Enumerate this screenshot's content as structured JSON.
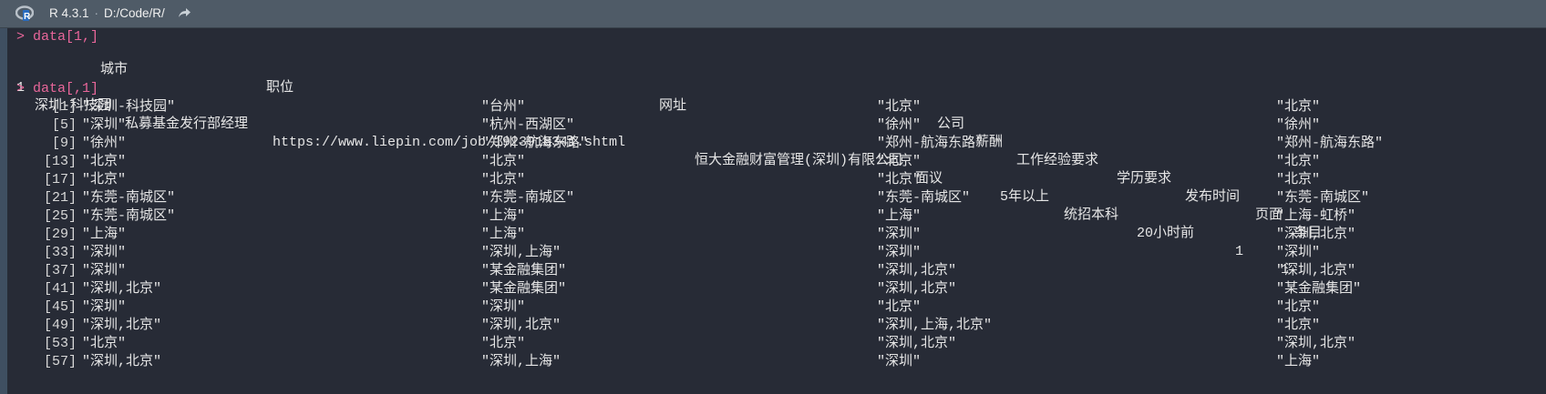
{
  "titlebar": {
    "r_version": "R 4.3.1",
    "path": "D:/Code/R/",
    "logo_icon": "r-logo-icon",
    "share_icon": "share-arrow-icon"
  },
  "console": {
    "cmd1": "> data[1,]",
    "header": [
      "城市",
      "职位",
      "网址",
      "公司",
      "薪酬",
      "工作经验要求",
      "学历要求",
      "发布时间",
      "页面",
      "条目"
    ],
    "row1": [
      "1",
      "深圳-科技园",
      "私募基金发行部经理",
      "https://www.liepin.com/job/1923918341.shtml",
      "恒大金融财富管理(深圳)有限公司",
      "面议",
      "5年以上",
      "统招本科",
      "20小时前",
      "1",
      "1"
    ],
    "cmd2": "> data[,1]",
    "vector_rows": [
      {
        "index": "[1]",
        "values": [
          "\"深圳-科技园\"",
          "\"台州\"",
          "\"北京\"",
          "\"北京\""
        ]
      },
      {
        "index": "[5]",
        "values": [
          "\"深圳\"",
          "\"杭州-西湖区\"",
          "\"徐州\"",
          "\"徐州\""
        ]
      },
      {
        "index": "[9]",
        "values": [
          "\"徐州\"",
          "\"郑州-航海东路\"",
          "\"郑州-航海东路\"",
          "\"郑州-航海东路\""
        ]
      },
      {
        "index": "[13]",
        "values": [
          "\"北京\"",
          "\"北京\"",
          "\"北京\"",
          "\"北京\""
        ]
      },
      {
        "index": "[17]",
        "values": [
          "\"北京\"",
          "\"北京\"",
          "\"北京\"",
          "\"北京\""
        ]
      },
      {
        "index": "[21]",
        "values": [
          "\"东莞-南城区\"",
          "\"东莞-南城区\"",
          "\"东莞-南城区\"",
          "\"东莞-南城区\""
        ]
      },
      {
        "index": "[25]",
        "values": [
          "\"东莞-南城区\"",
          "\"上海\"",
          "\"上海\"",
          "\"上海-虹桥\""
        ]
      },
      {
        "index": "[29]",
        "values": [
          "\"上海\"",
          "\"上海\"",
          "\"深圳\"",
          "\"深圳,北京\""
        ]
      },
      {
        "index": "[33]",
        "values": [
          "\"深圳\"",
          "\"深圳,上海\"",
          "\"深圳\"",
          "\"深圳\""
        ]
      },
      {
        "index": "[37]",
        "values": [
          "\"深圳\"",
          "\"某金融集团\"",
          "\"深圳,北京\"",
          "\"深圳,北京\""
        ]
      },
      {
        "index": "[41]",
        "values": [
          "\"深圳,北京\"",
          "\"某金融集团\"",
          "\"深圳,北京\"",
          "\"某金融集团\""
        ]
      },
      {
        "index": "[45]",
        "values": [
          "\"深圳\"",
          "\"深圳\"",
          "\"北京\"",
          "\"北京\""
        ]
      },
      {
        "index": "[49]",
        "values": [
          "\"深圳,北京\"",
          "\"深圳,北京\"",
          "\"深圳,上海,北京\"",
          "\"北京\""
        ]
      },
      {
        "index": "[53]",
        "values": [
          "\"北京\"",
          "\"北京\"",
          "\"深圳,北京\"",
          "\"深圳,北京\""
        ]
      },
      {
        "index": "[57]",
        "values": [
          "\"深圳,北京\"",
          "\"深圳,上海\"",
          "\"深圳\"",
          "\"上海\""
        ]
      }
    ]
  },
  "colors": {
    "prompt": "#e9669a",
    "background": "#272b36",
    "titlebar": "#4f5b67"
  }
}
